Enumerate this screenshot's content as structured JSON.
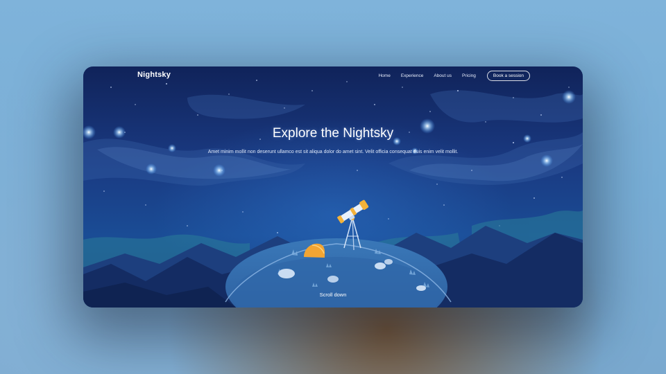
{
  "site": {
    "logo": "Nightsky"
  },
  "nav": {
    "links": [
      "Home",
      "Experience",
      "About us",
      "Pricing"
    ],
    "cta": "Book a session"
  },
  "hero": {
    "title": "Explore the Nightsky",
    "subtitle": "Amet minim mollit non deserunt ullamco est sit aliqua dolor do amet sint. Velit officia consequat duis enim velit mollit.",
    "scroll_label": "Scroll down"
  },
  "colors": {
    "sky_top": "#10235a",
    "sky_mid": "#1a4c95",
    "mountain_back": "#1d3f7e",
    "mountain_front": "#142c63",
    "teal_glow": "#2a7d99",
    "hill": "#2e64a8",
    "telescope_accent": "#f3b23a",
    "rock_orange": "#f2a533"
  },
  "icons": [
    "telescope-illustration",
    "rock-illustration",
    "star-glow"
  ]
}
